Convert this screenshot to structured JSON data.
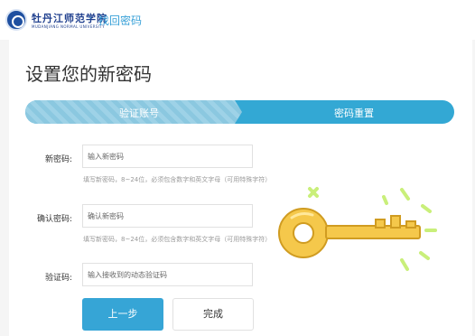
{
  "header": {
    "school_name": "牡丹江师范学院",
    "school_en": "MUDANJIANG NORMAL UNIVERSITY",
    "separator": "·",
    "page_name": "找回密码"
  },
  "main": {
    "title": "设置您的新密码",
    "steps": [
      {
        "label": "验证账号"
      },
      {
        "label": "密码重置"
      }
    ],
    "form": {
      "new_password": {
        "label": "新密码:",
        "placeholder": "输入新密码",
        "hint": "填写新密码，8~24位，必须包含数字和英文字母（可用特殊字符）"
      },
      "confirm_password": {
        "label": "确认密码:",
        "placeholder": "确认新密码",
        "hint": "填写新密码，8~24位，必须包含数字和英文字母（可用特殊字符）"
      },
      "verification_code": {
        "label": "验证码:",
        "placeholder": "输入接收到的动态验证码"
      }
    },
    "buttons": {
      "prev": "上一步",
      "done": "完成"
    }
  },
  "colors": {
    "accent": "#36a5d6",
    "brand": "#1f3f8e",
    "key": "#f5c84b"
  },
  "icons": {
    "logo": "university-logo",
    "illustration": "key-icon"
  }
}
